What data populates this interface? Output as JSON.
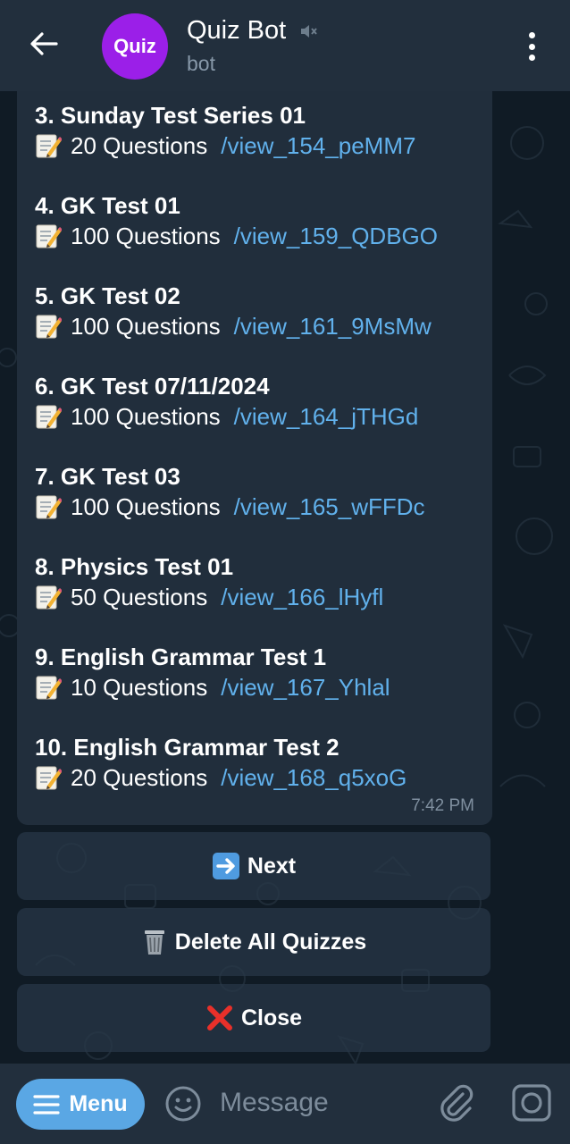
{
  "header": {
    "title": "Quiz Bot",
    "subtitle": "bot",
    "avatar_text": "Quiz",
    "icons": {
      "back": "arrow-left-icon",
      "mute": "muted-speaker-icon",
      "more": "more-vertical-icon"
    }
  },
  "message": {
    "items": [
      {
        "title": "3. Sunday Test Series 01",
        "count": "20 Questions",
        "link": "/view_154_peMM7"
      },
      {
        "title": "4. GK Test 01",
        "count": "100 Questions",
        "link": "/view_159_QDBGO"
      },
      {
        "title": "5. GK Test 02",
        "count": "100 Questions",
        "link": "/view_161_9MsMw"
      },
      {
        "title": "6. GK Test 07/11/2024",
        "count": "100 Questions",
        "link": "/view_164_jTHGd"
      },
      {
        "title": "7. GK Test 03",
        "count": "100 Questions",
        "link": "/view_165_wFFDc"
      },
      {
        "title": "8. Physics Test 01",
        "count": "50 Questions",
        "link": "/view_166_lHyfl"
      },
      {
        "title": "9. English Grammar Test 1",
        "count": "10 Questions",
        "link": "/view_167_Yhlal"
      },
      {
        "title": "10. English Grammar Test 2",
        "count": "20 Questions",
        "link": "/view_168_q5xoG"
      }
    ],
    "time": "7:42 PM",
    "item_icon": "memo-icon"
  },
  "keyboard": {
    "next_label": "Next",
    "delete_label": "Delete All Quizzes",
    "close_label": "Close"
  },
  "input_bar": {
    "menu_label": "Menu",
    "placeholder": "Message"
  },
  "colors": {
    "header_bg": "#222f3d",
    "bubble_bg": "#212e3c",
    "link": "#61b1ec",
    "menu_button": "#5aa7e4",
    "avatar": "#9b1fe8"
  }
}
